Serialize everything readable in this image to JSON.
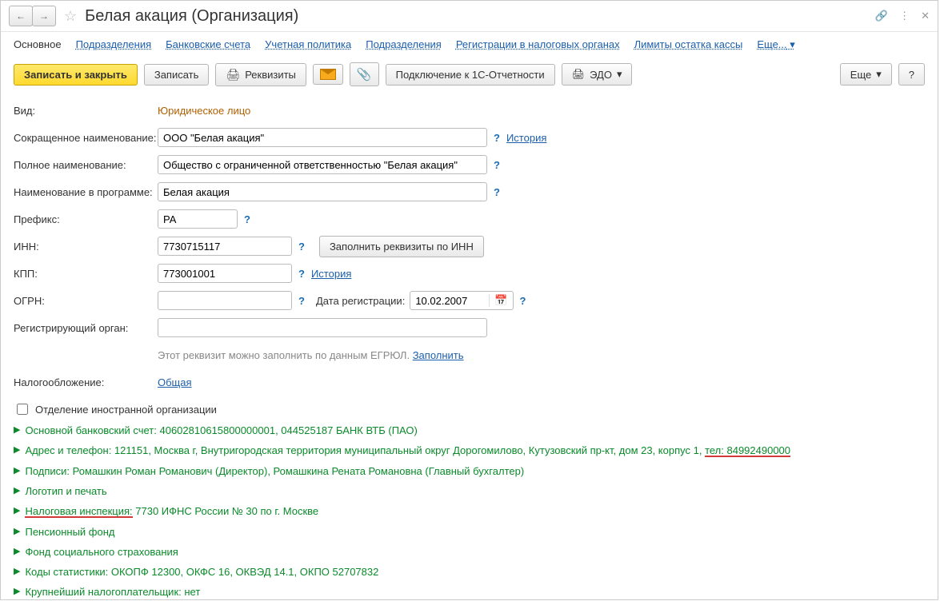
{
  "title": "Белая акация (Организация)",
  "nav_tabs": {
    "main": "Основное",
    "subdiv": "Подразделения",
    "bank": "Банковские счета",
    "policy": "Учетная политика",
    "subdiv2": "Подразделения",
    "tax_reg": "Регистрации в налоговых органах",
    "limits": "Лимиты остатка кассы",
    "more": "Еще..."
  },
  "toolbar": {
    "save_close": "Записать и закрыть",
    "save": "Записать",
    "requisites": "Реквизиты",
    "connect_1c": "Подключение к 1С-Отчетности",
    "edo": "ЭДО",
    "more": "Еще",
    "help": "?"
  },
  "fields": {
    "vid_lbl": "Вид:",
    "vid_val": "Юридическое лицо",
    "short_lbl": "Сокращенное наименование:",
    "short_val": "ООО \"Белая акация\"",
    "history": "История",
    "full_lbl": "Полное наименование:",
    "full_val": "Общество с ограниченной ответственностью \"Белая акация\"",
    "prog_lbl": "Наименование в программе:",
    "prog_val": "Белая акация",
    "prefix_lbl": "Префикс:",
    "prefix_val": "РА",
    "inn_lbl": "ИНН:",
    "inn_val": "7730715117",
    "inn_btn": "Заполнить реквизиты по ИНН",
    "kpp_lbl": "КПП:",
    "kpp_val": "773001001",
    "ogrn_lbl": "ОГРН:",
    "ogrn_val": "",
    "regdate_lbl": "Дата регистрации:",
    "regdate_val": "10.02.2007",
    "regorgan_lbl": "Регистрирующий орган:",
    "regorgan_val": "",
    "egrul_hint": "Этот реквизит можно заполнить по данным ЕГРЮЛ.",
    "fill": "Заполнить",
    "tax_lbl": "Налогообложение:",
    "tax_val": "Общая",
    "foreign_chk": "Отделение иностранной организации"
  },
  "sections": {
    "bank": "Основной банковский счет: 40602810615800000001, 044525187 БАНК ВТБ (ПАО)",
    "address": "Адрес и телефон: 121151, Москва г, Внутригородская территория муниципальный округ Дорогомилово, Кутузовский пр-кт, дом 23, корпус 1, тел: 84992490000",
    "address_p1": "Адрес и телефон: 121151, Москва г, Внутригородская территория муниципальный округ Дорогомилово, Кутузовский пр-кт, дом 23, корпус 1, ",
    "address_p2": "тел: 84992490000",
    "sign": "Подписи: Ромашкин Роман Романович (Директор), Ромашкина Рената Романовна (Главный бухгалтер)",
    "logo": "Логотип и печать",
    "taxinsp_p1": "Налоговая инспекция:",
    "taxinsp_p2": " 7730 ИФНС России № 30 по г. Москве",
    "pension": "Пенсионный фонд",
    "socins": "Фонд социального страхования",
    "codes": "Коды статистики: ОКОПФ 12300, ОКФС 16, ОКВЭД 14.1, ОКПО 52707832",
    "biggest": "Крупнейший налогоплательщик: нет"
  }
}
